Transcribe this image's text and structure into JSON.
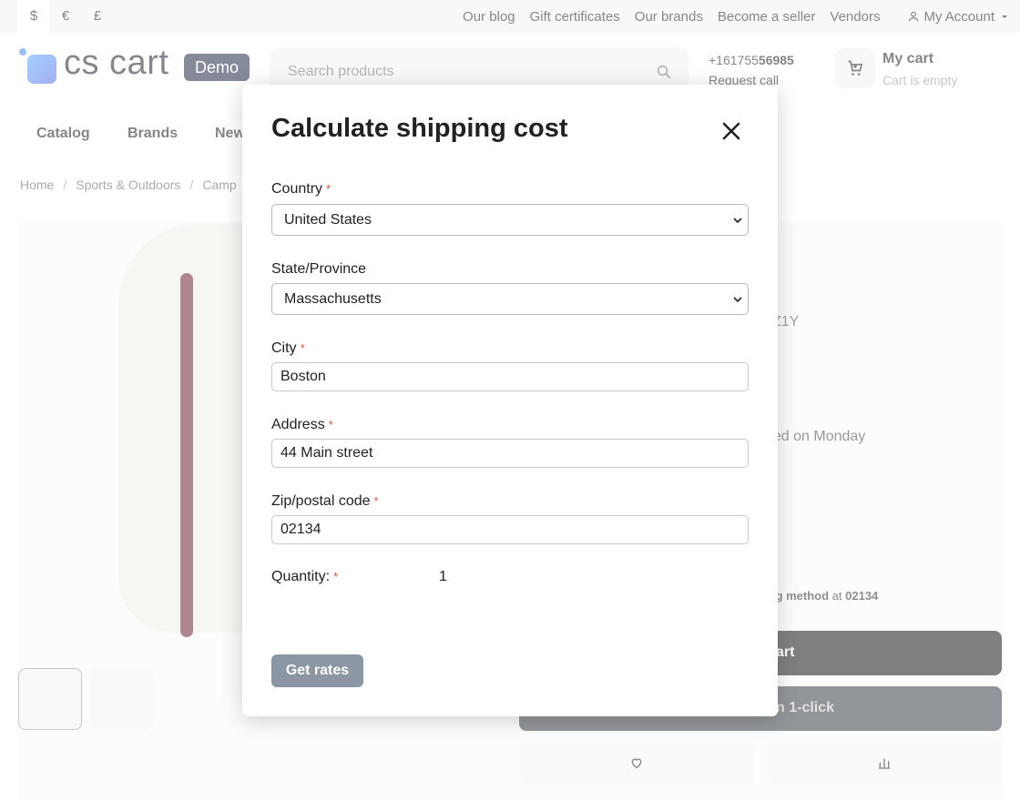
{
  "topbar": {
    "currencies": [
      "$",
      "€",
      "£"
    ],
    "links": [
      "Our blog",
      "Gift certificates",
      "Our brands",
      "Become a seller",
      "Vendors"
    ],
    "account_label": "My Account"
  },
  "header": {
    "logo_word": "cs cart",
    "logo_badge": "Demo",
    "search_placeholder": "Search products",
    "phone_prefix": "+161755",
    "phone_bold": "56985",
    "request_call": "Request call",
    "cart_title": "My cart",
    "cart_subtitle": "Cart is empty"
  },
  "nav": {
    "items": [
      "Catalog",
      "Brands",
      "New"
    ]
  },
  "breadcrumbs": {
    "items": [
      "Home",
      "Sports & Outdoors",
      "Camp"
    ],
    "separator": "/"
  },
  "product": {
    "sku_fragment": "Z1Y",
    "shipping_fragment": "ped on Monday",
    "method_fragment": "ing method",
    "method_at": "at",
    "method_zip": "02134",
    "add_to_cart_fragment": "art",
    "one_click_fragment": "n 1-click"
  },
  "modal": {
    "title": "Calculate shipping cost",
    "country_label": "Country",
    "country_value": "United States",
    "state_label": "State/Province",
    "state_value": "Massachusetts",
    "city_label": "City",
    "city_value": "Boston",
    "address_label": "Address",
    "address_value": "44 Main street",
    "zip_label": "Zip/postal code",
    "zip_value": "02134",
    "quantity_label": "Quantity:",
    "quantity_value": "1",
    "required_mark": "*",
    "get_rates_label": "Get rates"
  },
  "colors": {
    "required": "#e0573f",
    "get_rates_bg": "#8b97a4",
    "logo_badge_bg": "#1f2a44",
    "dark_button": "#161616"
  },
  "icons": [
    "search-icon",
    "user-icon",
    "cart-icon",
    "close-icon",
    "chevron-down-icon",
    "heart-icon",
    "compare-icon"
  ]
}
